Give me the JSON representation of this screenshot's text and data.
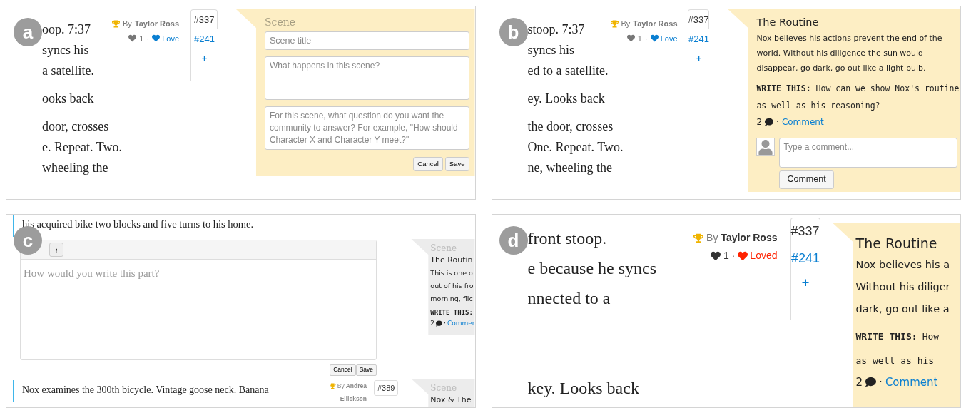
{
  "panels": [
    {
      "label": "a",
      "kind": "scene_form",
      "story": [
        [
          "oop. 7:37",
          "syncs his",
          "a satellite."
        ],
        [
          "ooks back"
        ],
        [
          "door, crosses",
          "e. Repeat. Two.",
          "wheeling the"
        ]
      ],
      "meta": {
        "by": "By",
        "author": "Taylor Ross",
        "likes": "1",
        "sep": "·",
        "love": "Love",
        "loved": false
      },
      "versions": [
        {
          "label": "#337",
          "selected": true
        },
        {
          "label": "#241",
          "selected": false
        }
      ],
      "add": "+",
      "callout": {
        "kind": "form",
        "heading": "Scene",
        "fields": [
          {
            "kind": "input",
            "placeholder": "Scene title"
          },
          {
            "kind": "textarea",
            "placeholder": "What happens in this scene?"
          },
          {
            "kind": "textarea",
            "placeholder": "For this scene, what question do you want the community to answer? For example, \"How should Character X and Character Y meet?\""
          }
        ],
        "buttons": [
          "Cancel",
          "Save"
        ]
      }
    },
    {
      "label": "b",
      "kind": "scene_detail",
      "story": [
        [
          "stoop. 7:37",
          "syncs his",
          "ed to a satellite."
        ],
        [
          "ey. Looks back"
        ],
        [
          "the door, crosses",
          "One. Repeat. Two.",
          "ne, wheeling the"
        ]
      ],
      "meta": {
        "by": "By",
        "author": "Taylor Ross",
        "likes": "1",
        "sep": "·",
        "love": "Love",
        "loved": false
      },
      "versions": [
        {
          "label": "#337",
          "selected": true
        },
        {
          "label": "#241",
          "selected": false
        }
      ],
      "add": "+",
      "callout": {
        "kind": "detail",
        "title": "The Routine",
        "lines": [
          "Nox believes his actions prevent the end of the",
          "world. Without his diligence the sun would",
          "disappear, go dark, go out like a light bulb."
        ],
        "prompt_label": "WRITE THIS:",
        "prompt_lines": [
          "How can we show Nox's routine",
          "as well as his reasoning?"
        ],
        "count": "2",
        "sep": "·",
        "link": "Comment",
        "comment_placeholder": "Type a comment...",
        "comment_button": "Comment"
      }
    },
    {
      "label": "c",
      "kind": "editor",
      "top_line": "his acquired bike two blocks and five turns to his home.",
      "toolbar": [
        "i"
      ],
      "placeholder": "How would you write this part?",
      "buttons": [
        "Cancel",
        "Save"
      ],
      "next_line": "Nox examines the 300th bicycle. Vintage goose neck. Banana",
      "next_meta": {
        "by": "By",
        "author_lines": [
          "Andrea",
          "Ellickson"
        ]
      },
      "next_versions": [
        {
          "label": "#389",
          "selected": true
        }
      ],
      "side": [
        {
          "heading": "Scene",
          "title": "The Routin",
          "lines": [
            "This is one o",
            "out of his fro",
            "morning, flic"
          ],
          "prompt_label": "WRITE THIS:",
          "count": "2",
          "sep": "·",
          "link": "Commer"
        },
        {
          "heading": "Scene",
          "title": "Nox & The"
        }
      ]
    },
    {
      "label": "d",
      "kind": "zoomed",
      "story": [
        [
          "front stoop.",
          "e because he syncs",
          "nnected to a"
        ],
        [
          "key. Looks back"
        ]
      ],
      "meta": {
        "by": "By",
        "author": "Taylor Ross",
        "likes": "1",
        "sep": "·",
        "love": "Loved",
        "loved": true
      },
      "versions": [
        {
          "label": "#337",
          "selected": true
        },
        {
          "label": "#241",
          "selected": false
        }
      ],
      "add": "+",
      "callout": {
        "kind": "detail",
        "title": "The Routine",
        "lines": [
          "Nox believes his a",
          "Without his diliger",
          "dark, go out like a"
        ],
        "prompt_label": "WRITE THIS:",
        "prompt_lines": [
          "How",
          "as well as his"
        ],
        "count": "2",
        "sep": "·",
        "link": "Comment"
      }
    }
  ]
}
